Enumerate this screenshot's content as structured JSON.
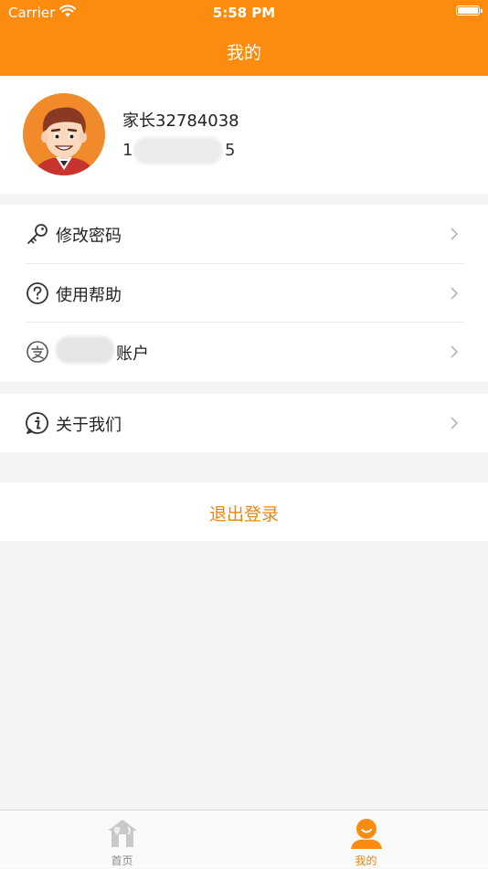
{
  "status_bar": {
    "carrier": "Carrier",
    "time": "5:58 PM"
  },
  "nav": {
    "title": "我的"
  },
  "profile": {
    "name": "家长32784038",
    "phone_start": "1",
    "phone_end": "5"
  },
  "menu": {
    "change_password": "修改密码",
    "help": "使用帮助",
    "account": "账户",
    "about": "关于我们"
  },
  "logout": {
    "label": "退出登录"
  },
  "tabbar": {
    "home": "首页",
    "mine": "我的"
  },
  "colors": {
    "accent": "#fb8c0f",
    "logout_text": "#f0850c",
    "tab_inactive": "#b9b9b9"
  },
  "icons": {
    "wifi": "wifi-icon",
    "battery": "battery-icon",
    "avatar": "avatar",
    "key": "key-icon",
    "help": "question-icon",
    "alipay": "alipay-icon",
    "info": "info-icon",
    "chevron": "chevron-right-icon",
    "home": "home-icon",
    "mine": "person-icon"
  }
}
